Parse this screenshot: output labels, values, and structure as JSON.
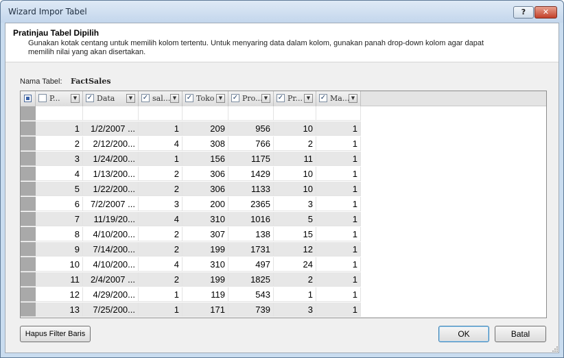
{
  "window": {
    "title": "Wizard Impor Tabel",
    "help_label": "?",
    "close_label": "✕"
  },
  "header": {
    "title": "Pratinjau Tabel Dipilih",
    "description": "Gunakan kotak centang untuk memilih kolom tertentu. Untuk menyaring data dalam kolom, gunakan panah drop-down kolom agar dapat memilih nilai yang akan disertakan."
  },
  "table_name": {
    "label": "Nama Tabel:",
    "value": "FactSales"
  },
  "grid": {
    "columns": [
      {
        "label": "P...",
        "checked": false
      },
      {
        "label": "Data",
        "checked": true
      },
      {
        "label": "sal...",
        "checked": true
      },
      {
        "label": "Toko",
        "checked": true
      },
      {
        "label": "Pro...",
        "checked": true
      },
      {
        "label": "Pr...",
        "checked": true
      },
      {
        "label": "Ma...",
        "checked": true
      }
    ],
    "rows": [
      [
        "",
        "",
        "",
        "",
        "",
        "",
        ""
      ],
      [
        "1",
        "1/2/2007 ...",
        "1",
        "209",
        "956",
        "10",
        "1"
      ],
      [
        "2",
        "2/12/200...",
        "4",
        "308",
        "766",
        "2",
        "1"
      ],
      [
        "3",
        "1/24/200...",
        "1",
        "156",
        "1175",
        "11",
        "1"
      ],
      [
        "4",
        "1/13/200...",
        "2",
        "306",
        "1429",
        "10",
        "1"
      ],
      [
        "5",
        "1/22/200...",
        "2",
        "306",
        "1133",
        "10",
        "1"
      ],
      [
        "6",
        "7/2/2007 ...",
        "3",
        "200",
        "2365",
        "3",
        "1"
      ],
      [
        "7",
        "11/19/20...",
        "4",
        "310",
        "1016",
        "5",
        "1"
      ],
      [
        "8",
        "4/10/200...",
        "2",
        "307",
        "138",
        "15",
        "1"
      ],
      [
        "9",
        "7/14/200...",
        "2",
        "199",
        "1731",
        "12",
        "1"
      ],
      [
        "10",
        "4/10/200...",
        "4",
        "310",
        "497",
        "24",
        "1"
      ],
      [
        "11",
        "2/4/2007 ...",
        "2",
        "199",
        "1825",
        "2",
        "1"
      ],
      [
        "12",
        "4/29/200...",
        "1",
        "119",
        "543",
        "1",
        "1"
      ],
      [
        "13",
        "7/25/200...",
        "1",
        "171",
        "739",
        "3",
        "1"
      ]
    ]
  },
  "buttons": {
    "filter": "Hapus Filter Baris",
    "ok": "OK",
    "cancel": "Batal"
  },
  "icons": {
    "checkbox_checked": "check-icon",
    "dropdown": "dropdown-arrow-icon",
    "select_all": "select-all-icon"
  }
}
